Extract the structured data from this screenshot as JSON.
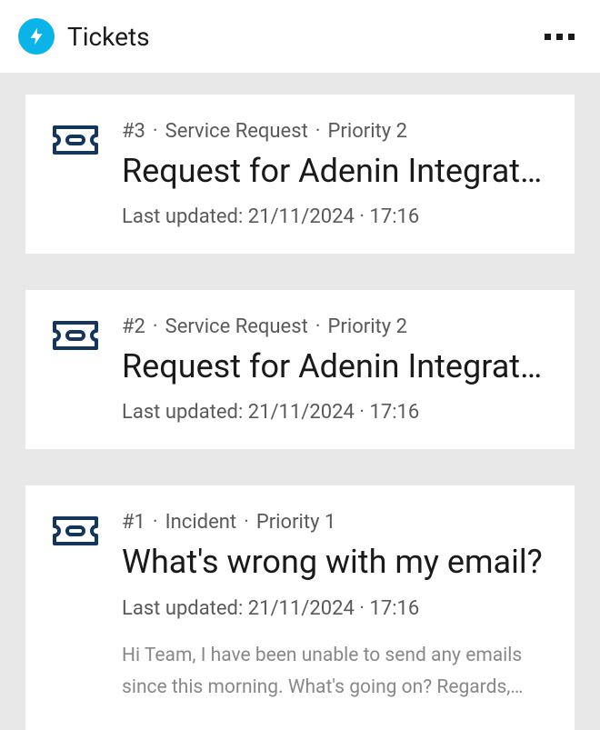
{
  "header": {
    "title": "Tickets"
  },
  "tickets": [
    {
      "id": "#3",
      "type": "Service Request",
      "priority": "Priority 2",
      "title": "Request for Adenin Integration Setup",
      "updated_label": "Last updated: 21/11/2024 · 17:16",
      "body": ""
    },
    {
      "id": "#2",
      "type": "Service Request",
      "priority": "Priority 2",
      "title": "Request for Adenin Integration Setup",
      "updated_label": "Last updated: 21/11/2024 · 17:16",
      "body": ""
    },
    {
      "id": "#1",
      "type": "Incident",
      "priority": "Priority 1",
      "title": "What's wrong with my email?",
      "updated_label": "Last updated: 21/11/2024 · 17:16",
      "body": "Hi Team, I have been unable to send any emails since this morning. What's going on? Regards, Adenin…"
    }
  ]
}
